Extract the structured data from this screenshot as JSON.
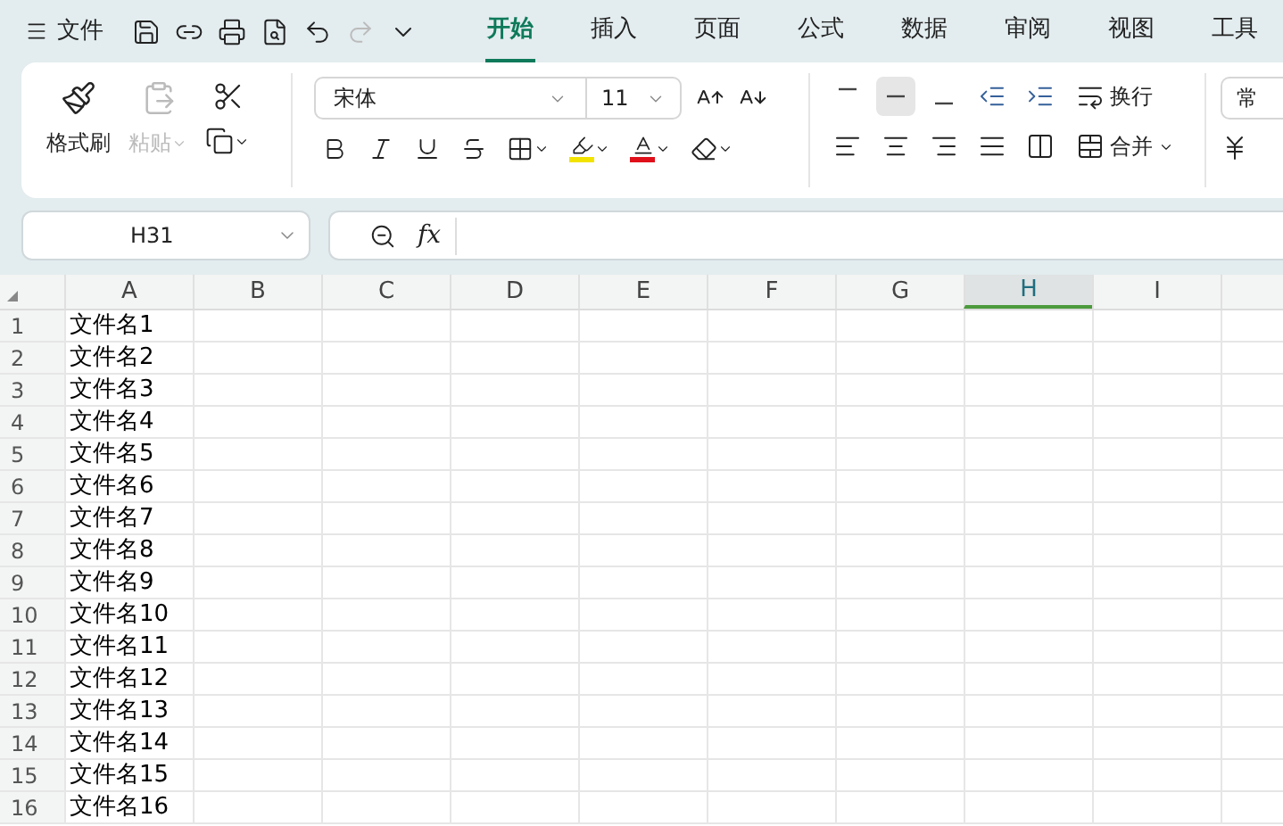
{
  "menu": {
    "label": "文件"
  },
  "tabs": [
    {
      "label": "开始",
      "selected": true
    },
    {
      "label": "插入",
      "selected": false
    },
    {
      "label": "页面",
      "selected": false
    },
    {
      "label": "公式",
      "selected": false
    },
    {
      "label": "数据",
      "selected": false
    },
    {
      "label": "审阅",
      "selected": false
    },
    {
      "label": "视图",
      "selected": false
    },
    {
      "label": "工具",
      "selected": false
    }
  ],
  "ribbon": {
    "format_painter": {
      "label": "格式刷",
      "disabled": false
    },
    "paste": {
      "label": "粘贴",
      "disabled": true
    },
    "font_name": "宋体",
    "font_size": "11",
    "wrap_text": {
      "label": "换行"
    },
    "merge": {
      "label": "合并"
    },
    "number_format": "常",
    "align_middle_selected": true
  },
  "formula_bar": {
    "name_box": "H31",
    "fx": "fx"
  },
  "sheet": {
    "columns": [
      {
        "label": "A",
        "selected": false
      },
      {
        "label": "B",
        "selected": false
      },
      {
        "label": "C",
        "selected": false
      },
      {
        "label": "D",
        "selected": false
      },
      {
        "label": "E",
        "selected": false
      },
      {
        "label": "F",
        "selected": false
      },
      {
        "label": "G",
        "selected": false
      },
      {
        "label": "H",
        "selected": true
      },
      {
        "label": "I",
        "selected": false
      }
    ],
    "rows": [
      {
        "number": "1",
        "cells": [
          "文件名1"
        ]
      },
      {
        "number": "2",
        "cells": [
          "文件名2"
        ]
      },
      {
        "number": "3",
        "cells": [
          "文件名3"
        ]
      },
      {
        "number": "4",
        "cells": [
          "文件名4"
        ]
      },
      {
        "number": "5",
        "cells": [
          "文件名5"
        ]
      },
      {
        "number": "6",
        "cells": [
          "文件名6"
        ]
      },
      {
        "number": "7",
        "cells": [
          "文件名7"
        ]
      },
      {
        "number": "8",
        "cells": [
          "文件名8"
        ]
      },
      {
        "number": "9",
        "cells": [
          "文件名9"
        ]
      },
      {
        "number": "10",
        "cells": [
          "文件名10"
        ]
      },
      {
        "number": "11",
        "cells": [
          "文件名11"
        ]
      },
      {
        "number": "12",
        "cells": [
          "文件名12"
        ]
      },
      {
        "number": "13",
        "cells": [
          "文件名13"
        ]
      },
      {
        "number": "14",
        "cells": [
          "文件名14"
        ]
      },
      {
        "number": "15",
        "cells": [
          "文件名15"
        ]
      },
      {
        "number": "16",
        "cells": [
          "文件名16"
        ]
      }
    ]
  }
}
